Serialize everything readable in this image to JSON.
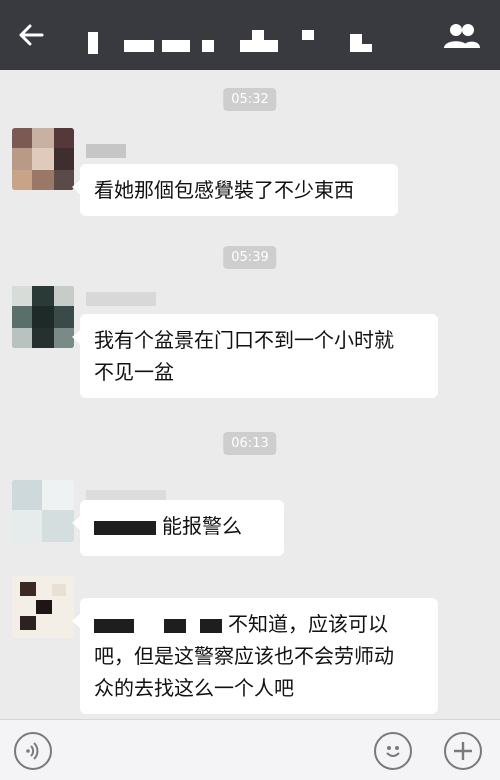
{
  "header": {
    "title": "",
    "back_icon": "back-arrow-icon",
    "members_icon": "group-members-icon"
  },
  "messages": [
    {
      "time": "05:32",
      "sender": "",
      "lines": [
        "看她那個包感覺裝了不少東西"
      ]
    },
    {
      "time": "05:39",
      "sender": "",
      "lines": [
        "我有个盆景在门口不到一个小时就",
        "不见一盆"
      ]
    },
    {
      "time": "06:13",
      "sender": "",
      "lines": [
        "能报警么"
      ]
    },
    {
      "time": "",
      "sender": "",
      "lines": [
        "不知道，应该可以",
        "吧，但是这警察应该也不会劳师动",
        "众的去找这么一个人吧"
      ]
    }
  ],
  "inputbar": {
    "voice_icon": "voice-icon",
    "emoji_icon": "emoji-icon",
    "plus_icon": "plus-icon"
  },
  "colors": {
    "header_bg": "#393a3f",
    "chat_bg": "#ebebeb",
    "bubble_bg": "#ffffff",
    "time_bg": "#cecece"
  }
}
